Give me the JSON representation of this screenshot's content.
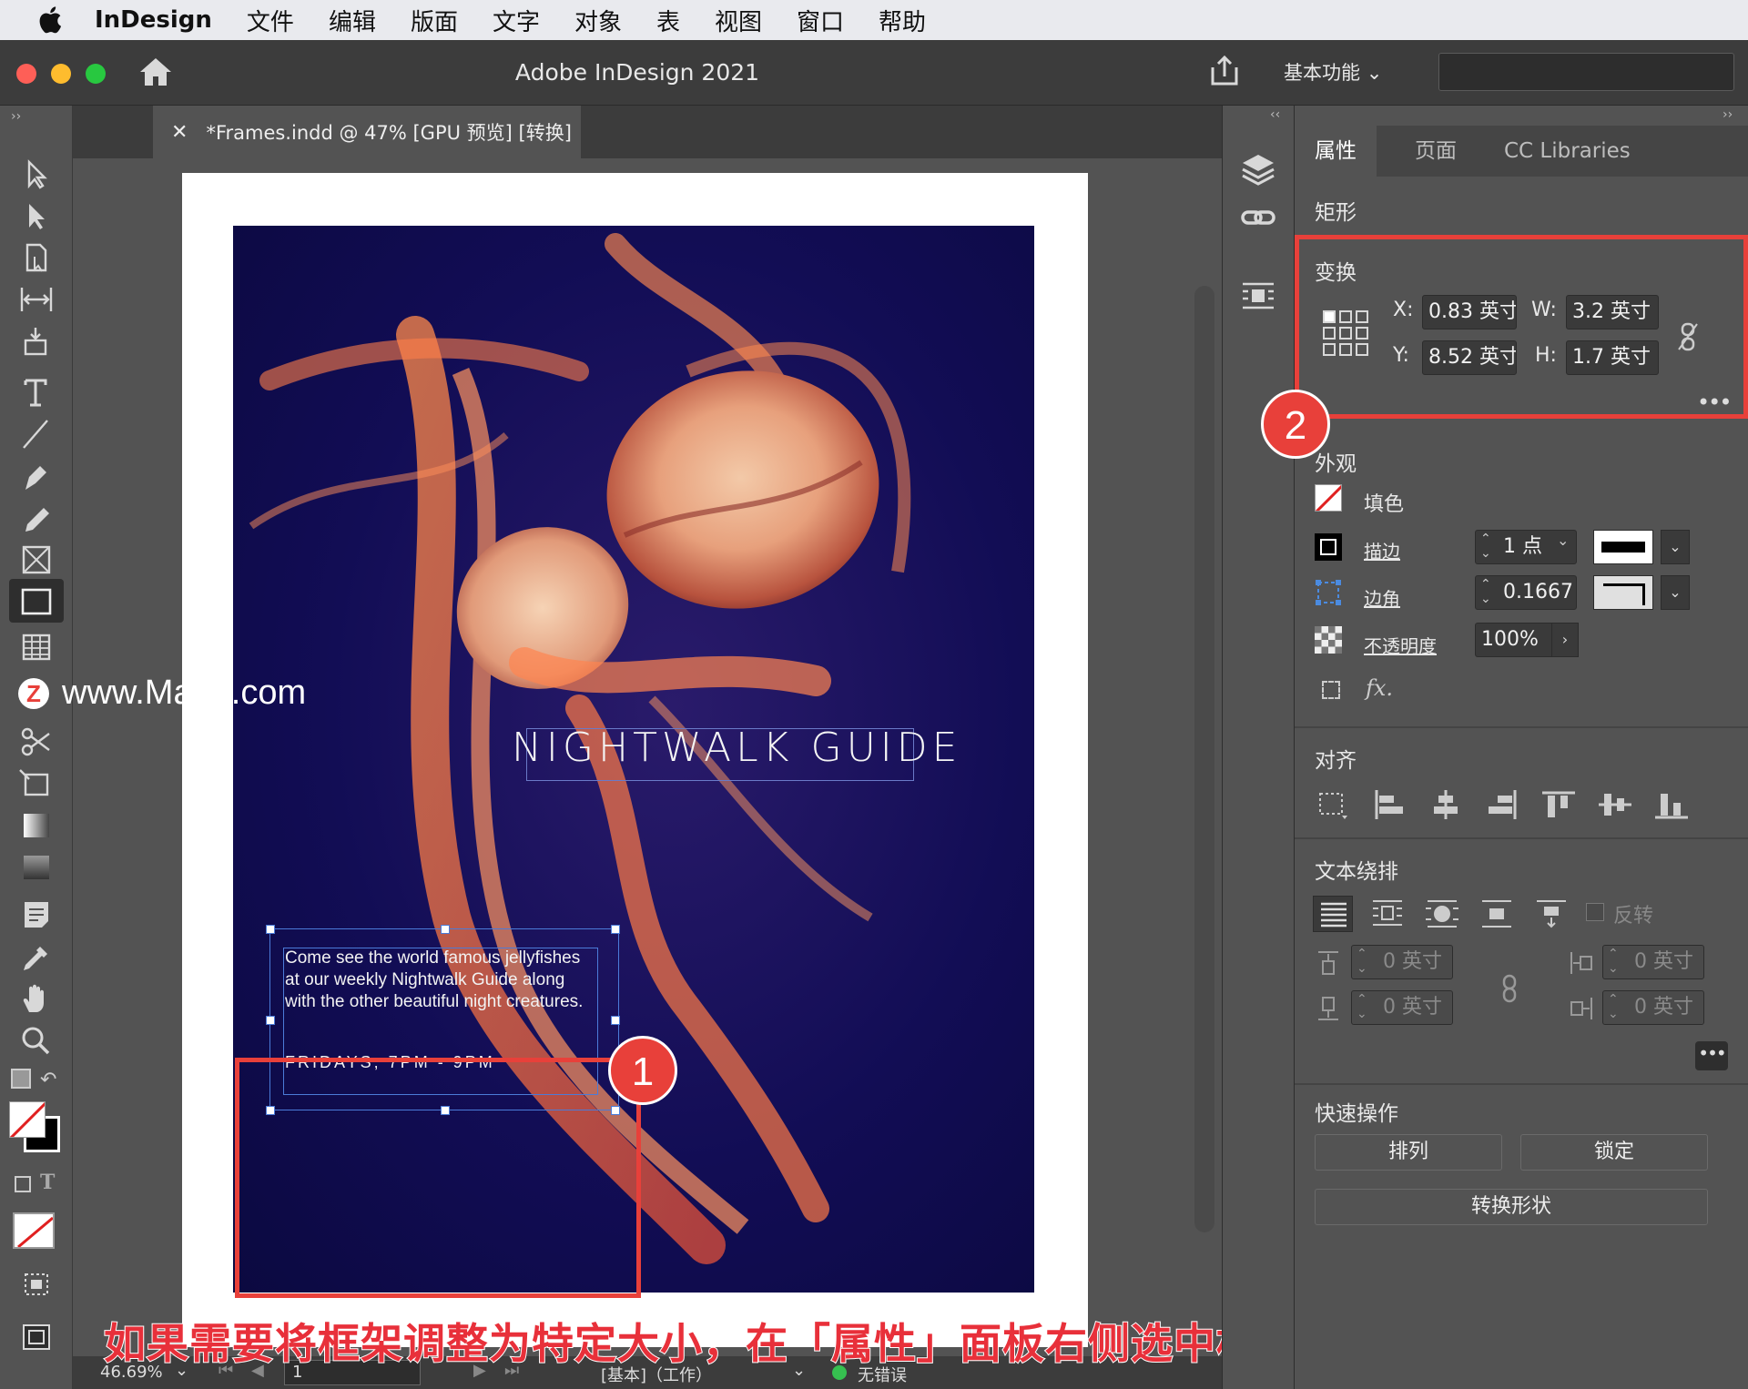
{
  "menubar": {
    "app": "InDesign",
    "items": [
      "文件",
      "编辑",
      "版面",
      "文字",
      "对象",
      "表",
      "视图",
      "窗口",
      "帮助"
    ]
  },
  "titlebar": {
    "title": "Adobe InDesign 2021",
    "workspace": "基本功能"
  },
  "document": {
    "tab_title": "*Frames.indd @ 47% [GPU 预览] [转换]",
    "headline": "NIGHTWALK GUIDE",
    "body_text": "Come see the world famous jellyfishes at our weekly Nightwalk Guide along with the other beautiful night creatures.",
    "schedule": "FRIDAYS, 7PM - 9PM"
  },
  "watermark": "www.MacZ.com",
  "panel": {
    "tabs": [
      "属性",
      "页面",
      "CC Libraries"
    ],
    "active_tab": "属性",
    "object_type": "矩形",
    "transform": {
      "title": "变换",
      "x_label": "X:",
      "x_value": "0.83 英寸",
      "y_label": "Y:",
      "y_value": "8.52 英寸",
      "w_label": "W:",
      "w_value": "3.2 英寸",
      "h_label": "H:",
      "h_value": "1.7 英寸"
    },
    "appearance": {
      "title": "外观",
      "fill_label": "填色",
      "stroke_label": "描边",
      "stroke_value": "1 点",
      "corner_label": "边角",
      "corner_value": "0.1667",
      "opacity_label": "不透明度",
      "opacity_value": "100%",
      "fx_label": "fx."
    },
    "align": {
      "title": "对齐"
    },
    "text_wrap": {
      "title": "文本绕排",
      "invert_label": "反转",
      "top_value": "0 英寸",
      "bottom_value": "0 英寸",
      "left_value": "0 英寸",
      "right_value": "0 英寸"
    },
    "quick_actions": {
      "title": "快速操作",
      "arrange": "排列",
      "lock": "锁定",
      "convert_shape": "转换形状"
    }
  },
  "statusbar": {
    "zoom": "46.69%",
    "page": "1",
    "style": "[基本]（工作）",
    "errors": "无错误"
  },
  "annotations": {
    "badge1": "1",
    "badge2": "2",
    "caption": "如果需要将框架调整为特定大小，在「属性」面板右侧选中框架后，将看到其属性"
  },
  "colors": {
    "accent": "#e8403a",
    "panel_bg": "#535353",
    "selection": "#4b7bd8"
  }
}
